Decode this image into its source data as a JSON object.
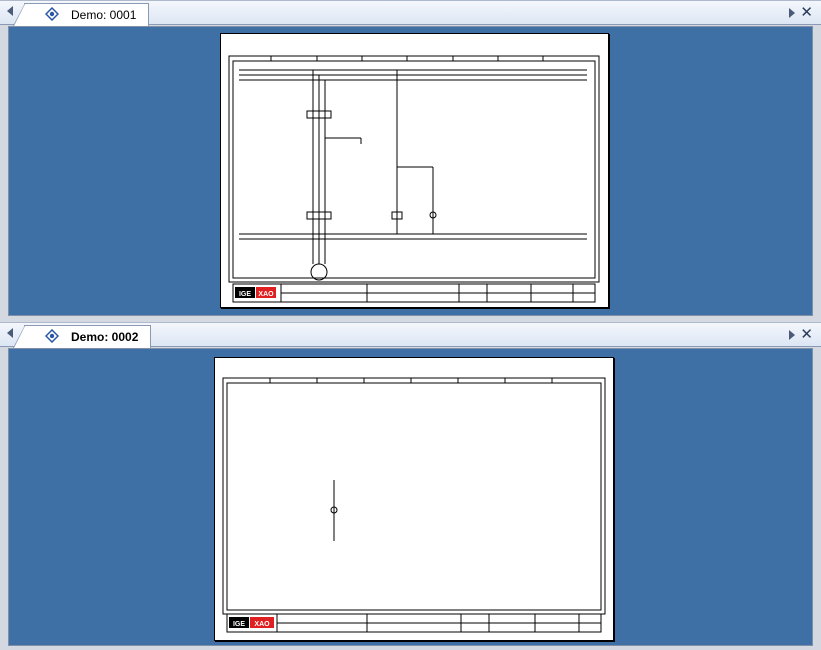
{
  "colors": {
    "workspace": "#3e6fa5",
    "tab_bg": "#ffffff",
    "logo_red": "#e02020"
  },
  "windows": [
    {
      "tab_title": "Demo: 0001",
      "icon": "document-diamond-icon",
      "active": false
    },
    {
      "tab_title": "Demo: 0002",
      "icon": "document-diamond-icon",
      "active": true
    }
  ],
  "titleblock": {
    "logo_left": "IGE",
    "logo_right": "XAO"
  }
}
